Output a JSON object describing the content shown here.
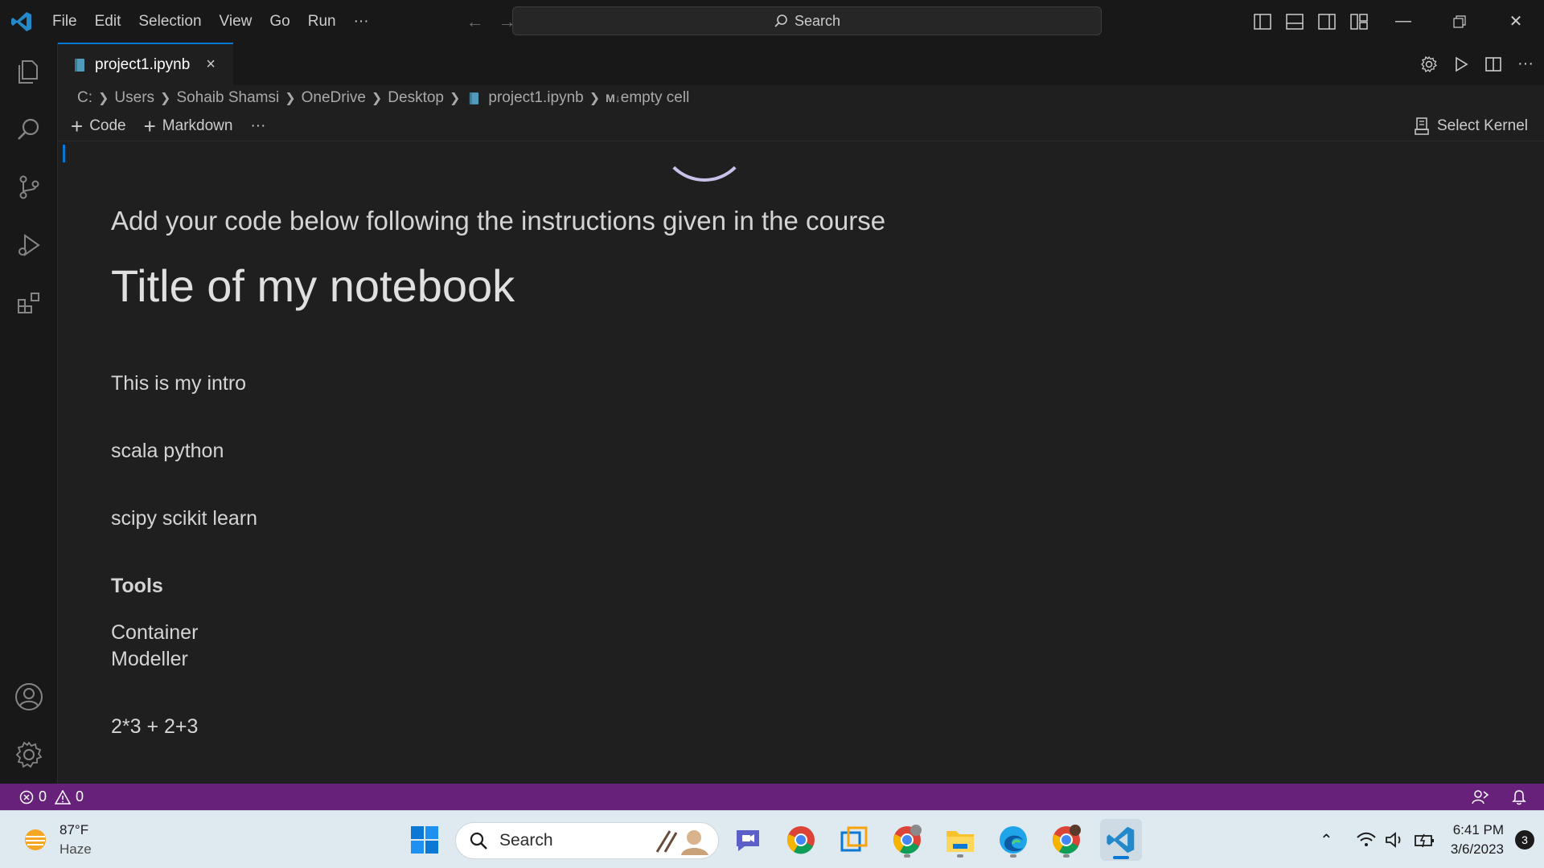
{
  "titlebar": {
    "menu": [
      "File",
      "Edit",
      "Selection",
      "View",
      "Go",
      "Run"
    ],
    "more": "···",
    "search_label": "Search"
  },
  "tab": {
    "filename": "project1.ipynb",
    "close": "×"
  },
  "breadcrumb": {
    "parts": [
      "C:",
      "Users",
      "Sohaib Shamsi",
      "OneDrive",
      "Desktop",
      "project1.ipynb"
    ],
    "cell_prefix": "M↓",
    "cell": "empty cell"
  },
  "notebook_toolbar": {
    "code_label": "Code",
    "markdown_label": "Markdown",
    "more": "···",
    "kernel_label": "Select Kernel"
  },
  "markdown": {
    "lead": "Add your code below following the instructions given in the course",
    "title": "Title of my notebook",
    "intro": "This is my intro",
    "line1": "scala python",
    "line2": "scipy scikit learn",
    "tools_heading": "Tools",
    "tools": [
      "Container",
      "Modeller"
    ],
    "expression": "2*3 + 2+3"
  },
  "statusbar": {
    "errors": "0",
    "warnings": "0"
  },
  "taskbar": {
    "weather_temp": "87°F",
    "weather_cond": "Haze",
    "search_label": "Search",
    "time": "6:41 PM",
    "date": "3/6/2023",
    "notification_count": "3"
  },
  "colors": {
    "accent": "#0078d4",
    "statusbar": "#68217a",
    "editor_bg": "#1f1f1f",
    "chrome_bg": "#181818"
  }
}
